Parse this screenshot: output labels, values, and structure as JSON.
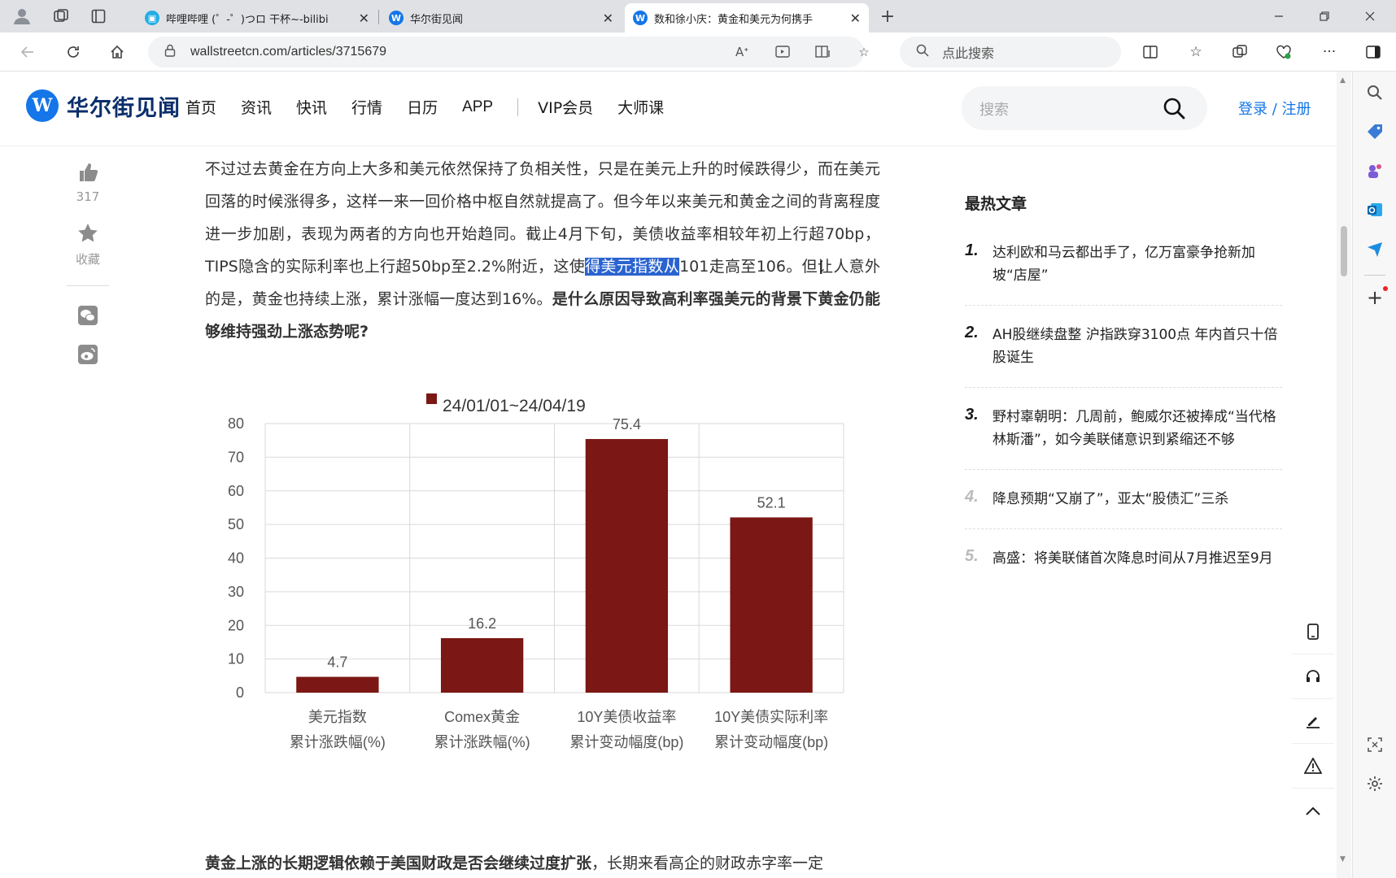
{
  "browser": {
    "tabs": [
      {
        "title": "哔哩哔哩 (゜-゜)つロ 干杯~-bilibi",
        "close": "✕"
      },
      {
        "title": "华尔街见闻",
        "close": "✕"
      },
      {
        "title": "数和徐小庆：黄金和美元为何携手",
        "close": "✕"
      }
    ],
    "new_tab": "+",
    "url": "wallstreetcn.com/articles/3715679",
    "search_placeholder": "点此搜索"
  },
  "site": {
    "logo_mark": "W",
    "logo_text": "华尔街见闻",
    "nav": [
      "首页",
      "资讯",
      "快讯",
      "行情",
      "日历",
      "APP"
    ],
    "nav_extra": [
      "VIP会员",
      "大师课"
    ],
    "search_placeholder": "搜索",
    "login": "登录 / 注册"
  },
  "share": {
    "likes": "317",
    "favorite": "收藏"
  },
  "article": {
    "p1_a": "不过过去黄金在方向上大多和美元依然保持了负相关性，只是在美元上升的时候跌得少，而在美元回落的时候涨得多，这样一来一回价格中枢自然就提高了。但今年以来美元和黄金之间的背离程度进一步加剧，表现为两者的方向也开始趋同。截止4月下旬，美债收益率相较年初上行超70bp，TIPS隐含的实际利率也上行超50bp至2.2%附近，这使",
    "p1_sel": "得美元指数从",
    "p1_b": "101走高至106。但让人意外的是，黄金也持续上涨，累计涨幅一度达到16%。",
    "p1_bold": "是什么原因导致高利率强美元的背景下黄金仍能够维持强劲上涨态势呢?",
    "p2_bold": "黄金上涨的长期逻辑依赖于美国财政是否会继续过度扩张",
    "p2_rest": "，长期来看高企的财政赤字率一定"
  },
  "chart_data": {
    "type": "bar",
    "legend": "24/01/01~24/04/19",
    "categories": [
      [
        "美元指数",
        "累计涨跌幅(%)"
      ],
      [
        "Comex黄金",
        "累计涨跌幅(%)"
      ],
      [
        "10Y美债收益率",
        "累计变动幅度(bp)"
      ],
      [
        "10Y美债实际利率",
        "累计变动幅度(bp)"
      ]
    ],
    "series": [
      {
        "name": "24/01/01~24/04/19",
        "values": [
          4.7,
          16.2,
          75.4,
          52.1
        ]
      }
    ],
    "data_labels": [
      "4.7",
      "16.2",
      "75.4",
      "52.1"
    ],
    "yticks": [
      "0",
      "10",
      "20",
      "30",
      "40",
      "50",
      "60",
      "70",
      "80"
    ],
    "ylim": [
      0,
      80
    ],
    "grid": true,
    "legend_position": "top",
    "bar_color": "#7b1714"
  },
  "hot": {
    "title": "最热文章",
    "items": [
      {
        "num": "1.",
        "text": "达利欧和马云都出手了，亿万富豪争抢新加坡“店屋”"
      },
      {
        "num": "2.",
        "text": "AH股继续盘整 沪指跌穿3100点 年内首只十倍股诞生"
      },
      {
        "num": "3.",
        "text": "野村辜朝明：几周前，鲍威尔还被捧成“当代格林斯潘”，如今美联储意识到紧缩还不够"
      },
      {
        "num": "4.",
        "text": "降息预期“又崩了”，亚太“股债汇”三杀"
      },
      {
        "num": "5.",
        "text": "高盛：将美联储首次降息时间从7月推迟至9月"
      }
    ]
  },
  "colors": {
    "accent": "#1476e8",
    "bar": "#7b1714",
    "selection": "#2a63d0"
  }
}
